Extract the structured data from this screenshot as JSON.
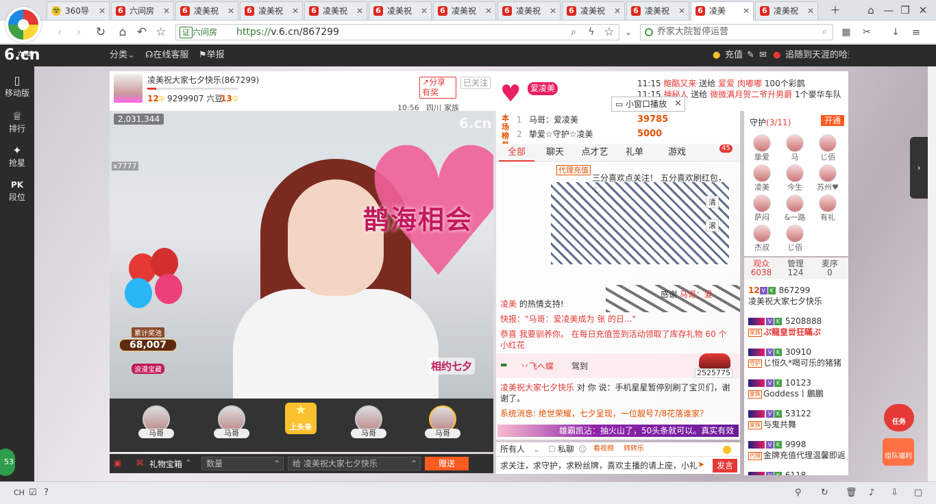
{
  "browser": {
    "tabs": [
      {
        "label": "360导",
        "icon": "g"
      },
      {
        "label": "六间房",
        "icon": "6"
      },
      {
        "label": "凌美祝",
        "icon": "6"
      },
      {
        "label": "凌美祝",
        "icon": "6"
      },
      {
        "label": "凌美祝",
        "icon": "6"
      },
      {
        "label": "凌美祝",
        "icon": "6"
      },
      {
        "label": "凌美祝",
        "icon": "6"
      },
      {
        "label": "凌美祝",
        "icon": "6"
      },
      {
        "label": "凌美祝",
        "icon": "6"
      },
      {
        "label": "凌美祝",
        "icon": "6"
      },
      {
        "label": "凌美",
        "icon": "6",
        "active": true
      },
      {
        "label": "凌美祝",
        "icon": "6"
      }
    ],
    "address": {
      "cert": "证",
      "site": "六间房",
      "scheme": "https://",
      "url": "v.6.cn/867299"
    },
    "search": {
      "text": "乔家大院暂停运营"
    }
  },
  "site": {
    "logo": "6.cn",
    "logo_small": "六间房",
    "menu": [
      "分类",
      "在线客服",
      "举报"
    ],
    "recharge": "充值",
    "user": "追随到天涯的哈"
  },
  "leftnav": [
    {
      "icon": "mobile-icon",
      "glyph": "▯",
      "label": "移动版"
    },
    {
      "icon": "rank-icon",
      "glyph": "♕",
      "label": "排行"
    },
    {
      "icon": "star-icon",
      "glyph": "✦",
      "label": "抢星"
    },
    {
      "icon": "pk-icon",
      "glyph": "PK",
      "label": "段位"
    }
  ],
  "room": {
    "title": "凌美祝大家七夕快乐(867299)",
    "level": "12",
    "beans": "9299907 六豆",
    "level2": "13",
    "share": "分享有奖",
    "follow": "已关注",
    "time": "10:56",
    "location": "四川",
    "family": "家族",
    "badge": "爱凌美",
    "viewers": "2,031,344",
    "x7777": "x7777",
    "watermark": "6.cn",
    "gift_name": "鹊海相会",
    "jackpot_label": "累计奖池",
    "jackpot_amount": "68,007",
    "jackpot_title": "浪漫宝藏",
    "qixi": "相约七夕"
  },
  "guests": [
    {
      "name": "马哥"
    },
    {
      "name": "马哥"
    },
    {
      "name": "马哥"
    },
    {
      "name": "马哥"
    }
  ],
  "toutiao": "上头条",
  "giftbar": {
    "box": "礼物宝箱",
    "qty_placeholder": "数量",
    "to": "给 凌美祝大家七夕快乐",
    "send": "赠送"
  },
  "rank": {
    "title": "本场榜单",
    "items": [
      {
        "n": "1",
        "name": "马哥：爱凌美",
        "value": "39785"
      },
      {
        "n": "2",
        "name": "挚爱☆守护☆凌美",
        "value": "5000"
      }
    ]
  },
  "chat_tabs": [
    "全部",
    "聊天",
    "点才艺",
    "礼单",
    "游戏"
  ],
  "chat_tab_badge": "45",
  "chat": {
    "m1_tag": "代理充值",
    "m1_text": "三分喜欢点关注！ 五分喜欢刷红包， 七",
    "clear": "清",
    "scroll": "滚",
    "thanks_user": "马哥：爱",
    "thanks_prefix": "感谢",
    "thanks_suffix": "凌美",
    "thanks_end": "的热情支持!",
    "news": "快报：\"马哥：爱凌美成为 张 的日...\"",
    "congrats": "恭喜 我要驯养你。 在每日充值签到活动领取了库存礼物 60 个小红花",
    "car_user": "丷飞へ蝶",
    "car_action": "驾到",
    "car_value": "2525775",
    "reply_from": "凌美祝大家七夕快乐",
    "reply_to": "对 你 说：",
    "reply_text": "手机星星暂停别刷了宝贝们，谢谢了。",
    "system": "系统消息: 绝世荣耀，七夕呈现，一位靓号7/8花落谁家？",
    "redpack": "雄霸凯沾：抽火山了，50头条就可以。真实有效"
  },
  "chattool": {
    "target": "所有人",
    "private": "私聊",
    "tags": "看视频",
    "lucky": "转转乐"
  },
  "chat_input": "求关注，求守护，求粉丝牌，喜欢主播的请上座，小礼",
  "chat_send": "发言",
  "guard": {
    "title": "守护",
    "count": "(3/11)",
    "open": "开通",
    "members": [
      "挚爱",
      "马",
      "じ佰",
      "凌美",
      "今生",
      "苏州♥",
      "萨闷",
      "&一路",
      "有礼",
      "杰叔",
      "じ佰"
    ]
  },
  "audience_tabs": [
    {
      "label": "观众",
      "count": "6038"
    },
    {
      "label": "管理",
      "count": "124"
    },
    {
      "label": "麦序",
      "count": "0"
    }
  ],
  "audience": [
    {
      "level": "12",
      "id": "867299",
      "name": "凌美祝大家七夕快乐",
      "red": false,
      "tag": ""
    },
    {
      "level": "",
      "id": "5208888",
      "name": "ぷ龍皇丗狂瞞ぷ",
      "red": true,
      "tag": "家族"
    },
    {
      "level": "",
      "id": "30910",
      "name": "じ恒久*喝可乐的猪猪",
      "red": false,
      "tag": "守护"
    },
    {
      "level": "",
      "id": "10123",
      "name": "Goddess丨鵬鵬",
      "red": false,
      "tag": "家族"
    },
    {
      "level": "",
      "id": "53122",
      "name": "与鬼共舞",
      "red": false,
      "tag": "家族"
    },
    {
      "level": "",
      "id": "9998",
      "name": "金牌充值代理温馨即返",
      "red": false,
      "tag": "代理"
    },
    {
      "level": "",
      "id": "6118",
      "name": "",
      "red": false,
      "tag": ""
    }
  ],
  "feed": [
    {
      "time": "11:15",
      "user": "鲍酷又来",
      "verb": "送给",
      "target": "爱爱",
      "extra": "肉嘟嘟",
      "gift": "100个彩鹊"
    },
    {
      "time": "11:15",
      "user": "神秘人",
      "verb": "送给",
      "target": "微微满月贺二爷升男爵",
      "extra": "",
      "gift": "1个豪华车队"
    }
  ],
  "miniplay": "小窗口播放",
  "task1": "任务",
  "task2": "组队福利",
  "greenball": "53",
  "taskbar": {
    "ime": "CH"
  }
}
